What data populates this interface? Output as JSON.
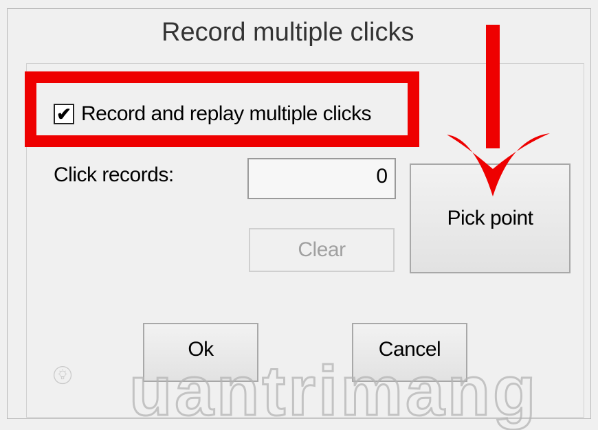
{
  "dialog": {
    "title": "Record multiple clicks",
    "checkbox": {
      "label": "Record and replay multiple clicks",
      "checked": true,
      "glyph": "✔"
    },
    "records": {
      "label": "Click records:",
      "value": "0"
    },
    "buttons": {
      "clear": "Clear",
      "pick_point": "Pick point",
      "ok": "Ok",
      "cancel": "Cancel"
    }
  },
  "annotations": {
    "highlight_color": "#ee0000",
    "arrow_color": "#ee0000",
    "arrow_direction": "down",
    "arrow_icon": "arrow-down-icon"
  },
  "watermark": {
    "text": "uantrimang",
    "logo_icon": "lightbulb-icon"
  }
}
